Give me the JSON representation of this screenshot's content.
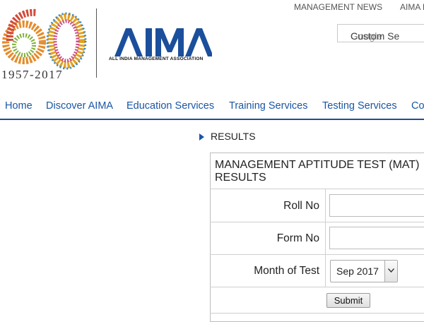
{
  "header": {
    "anniversary_years": "1957-2017",
    "org_short": "AIMA",
    "org_full": "ALL INDIA MANAGEMENT ASSOCIATION",
    "top_links": [
      "MANAGEMENT NEWS",
      "AIMA E"
    ],
    "search": {
      "brand": "Google",
      "placeholder": "Custom Se"
    },
    "brand_color": "#1a56a5"
  },
  "nav": {
    "items": [
      "Home",
      "Discover AIMA",
      "Education Services",
      "Training Services",
      "Testing Services",
      "Co"
    ]
  },
  "breadcrumb": {
    "label": "RESULTS"
  },
  "form": {
    "title_line1": "MANAGEMENT APTITUDE TEST (MAT)",
    "title_line2": "RESULTS",
    "roll_label": "Roll No",
    "roll_value": "",
    "form_label": "Form No",
    "form_value": "",
    "month_label": "Month of Test",
    "month_selected": "Sep 2017",
    "submit_label": "Submit"
  },
  "icons": {
    "logo": "aima-60-years-logo",
    "arrow": "triangle-right-icon",
    "dropdown": "chevron-down-icon"
  }
}
